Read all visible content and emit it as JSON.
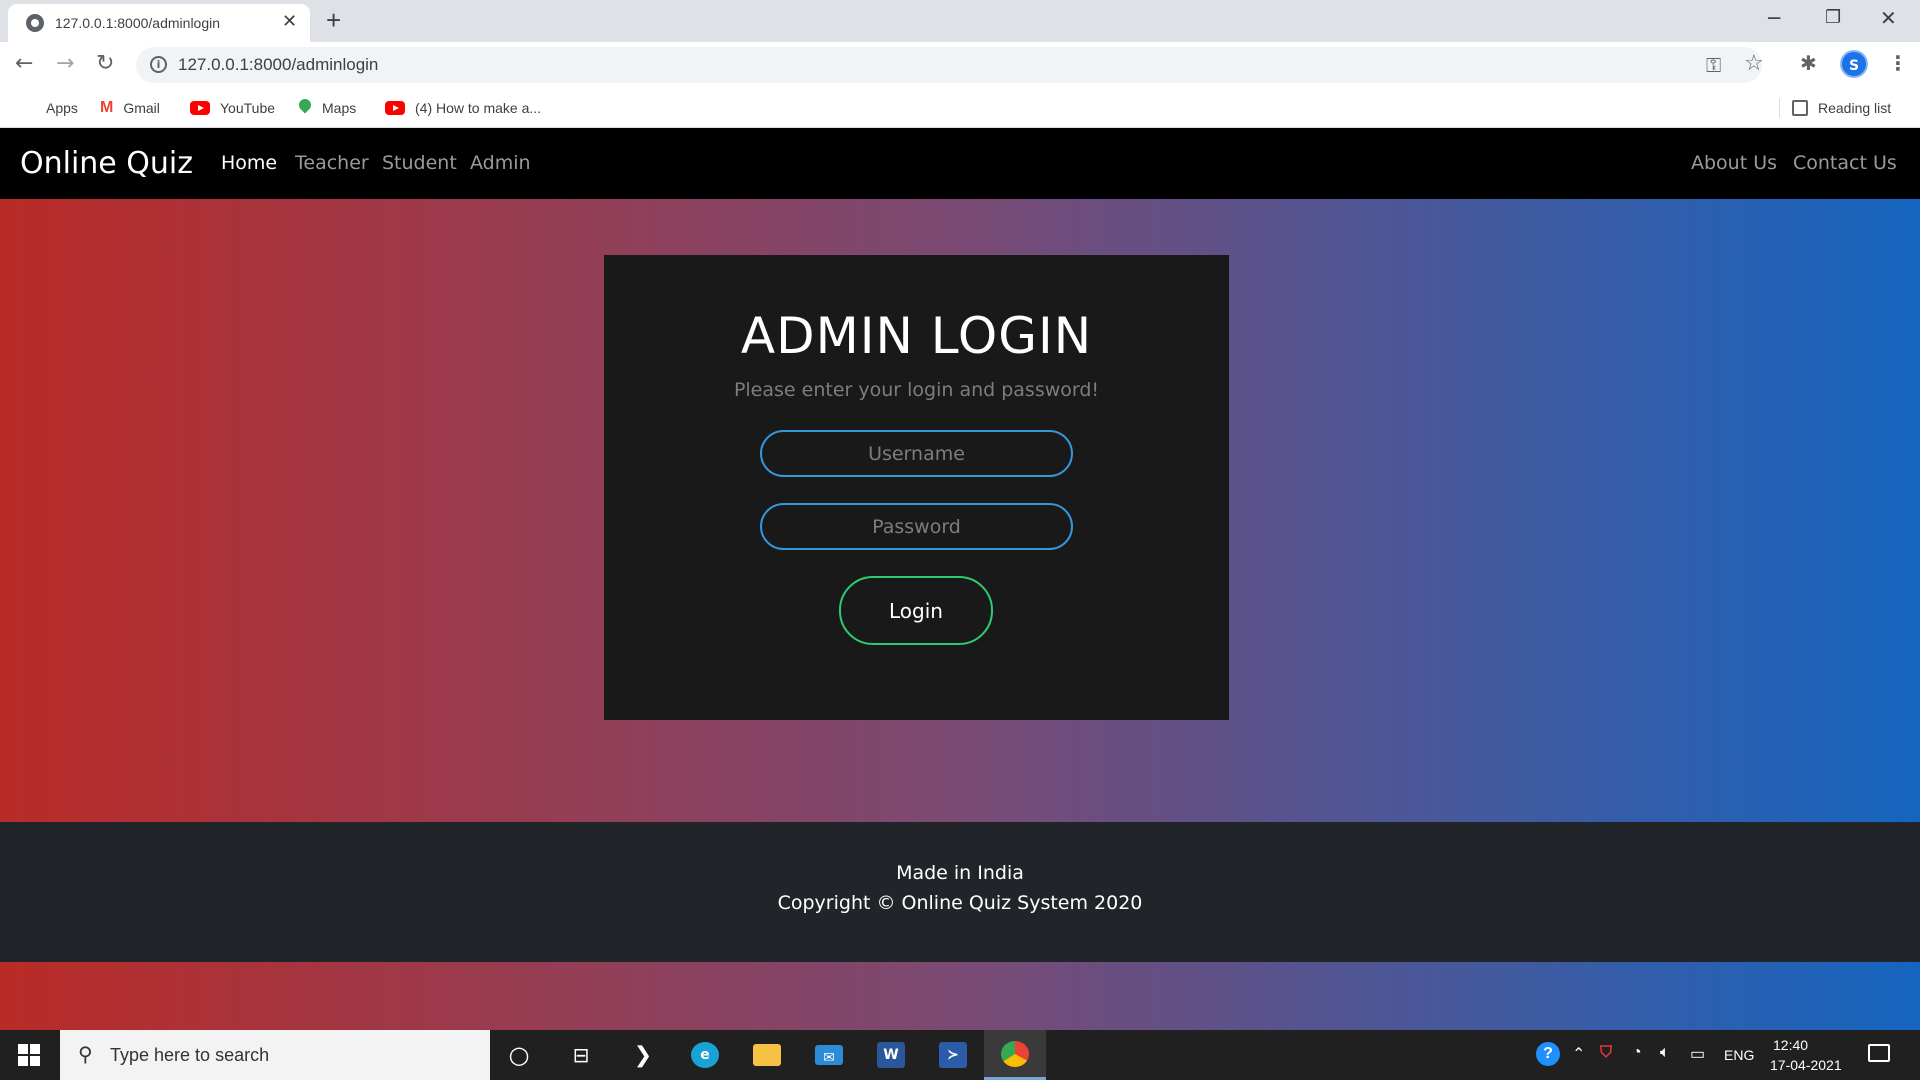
{
  "browser": {
    "tab_title": "127.0.0.1:8000/adminlogin",
    "url": "127.0.0.1:8000/adminlogin",
    "profile_initial": "S",
    "bookmarks": {
      "apps": "Apps",
      "gmail": "Gmail",
      "youtube": "YouTube",
      "maps": "Maps",
      "video": "(4) How to make a...",
      "reading_list": "Reading list"
    }
  },
  "site": {
    "brand": "Online Quiz",
    "nav": {
      "home": "Home",
      "teacher": "Teacher",
      "student": "Student",
      "admin": "Admin",
      "about": "About Us",
      "contact": "Contact Us"
    },
    "login": {
      "title": "ADMIN LOGIN",
      "subtitle": "Please enter your login and password!",
      "username_placeholder": "Username",
      "password_placeholder": "Password",
      "button": "Login"
    },
    "footer": {
      "made_in": "Made in India",
      "copyright": "Copyright © Online Quiz System 2020"
    },
    "colors": {
      "gradient_start": "#b92b27",
      "gradient_end": "#1565c0",
      "field_border": "#3498db",
      "button_border": "#2ecc71"
    }
  },
  "taskbar": {
    "search_placeholder": "Type here to search",
    "language": "ENG",
    "time": "12:40",
    "date": "17-04-2021"
  }
}
